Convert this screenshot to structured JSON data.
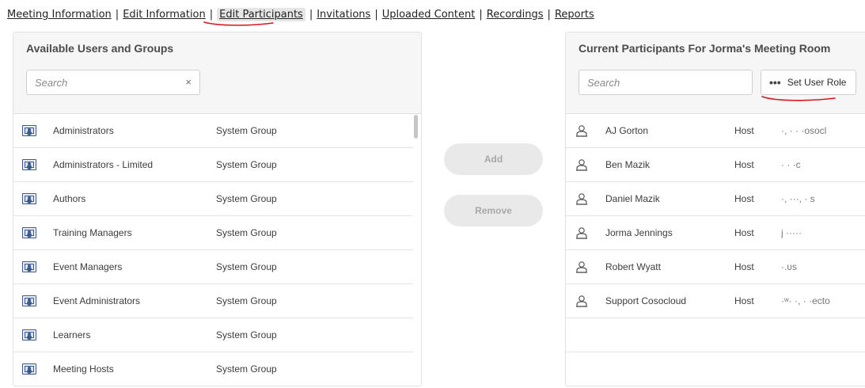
{
  "nav": {
    "items": [
      {
        "label": "Meeting Information"
      },
      {
        "label": "Edit Information"
      },
      {
        "label": "Edit Participants"
      },
      {
        "label": "Invitations"
      },
      {
        "label": "Uploaded Content"
      },
      {
        "label": "Recordings"
      },
      {
        "label": "Reports"
      }
    ],
    "active": "Edit Participants",
    "separator": "|"
  },
  "available": {
    "title": "Available Users and Groups",
    "search_placeholder": "Search",
    "clear_symbol": "×",
    "rows": [
      {
        "name": "Administrators",
        "type": "System Group"
      },
      {
        "name": "Administrators - Limited",
        "type": "System Group"
      },
      {
        "name": "Authors",
        "type": "System Group"
      },
      {
        "name": "Training Managers",
        "type": "System Group"
      },
      {
        "name": "Event Managers",
        "type": "System Group"
      },
      {
        "name": "Event Administrators",
        "type": "System Group"
      },
      {
        "name": "Learners",
        "type": "System Group"
      },
      {
        "name": "Meeting Hosts",
        "type": "System Group"
      }
    ],
    "row_icon": "group-icon"
  },
  "actions": {
    "add_label": "Add",
    "remove_label": "Remove"
  },
  "current": {
    "title": "Current Participants For Jorma's Meeting Room",
    "search_placeholder": "Search",
    "role_button_label": "Set User Role",
    "role_button_icon": "more-dots-icon",
    "rows": [
      {
        "name": "AJ Gorton",
        "role": "Host",
        "email": "·,         ·  ·  ·osocl"
      },
      {
        "name": "Ben Mazik",
        "role": "Host",
        "email": "·                  ·       ·c"
      },
      {
        "name": "Daniel Mazik",
        "role": "Host",
        "email": "·,      ···,    ·  s"
      },
      {
        "name": "Jorma Jennings",
        "role": "Host",
        "email": "j                    ·····"
      },
      {
        "name": "Robert Wyatt",
        "role": "Host",
        "email": "                             ·.ʋs"
      },
      {
        "name": "Support Cosocloud",
        "role": "Host",
        "email": "·ʷ·      ·,     ·  ·ecto"
      }
    ],
    "row_icon": "user-icon"
  },
  "colors": {
    "annotation_red": "#d8141c",
    "panel_header_bg": "#f6f6f6",
    "button_disabled_bg": "#e9e9e9"
  }
}
